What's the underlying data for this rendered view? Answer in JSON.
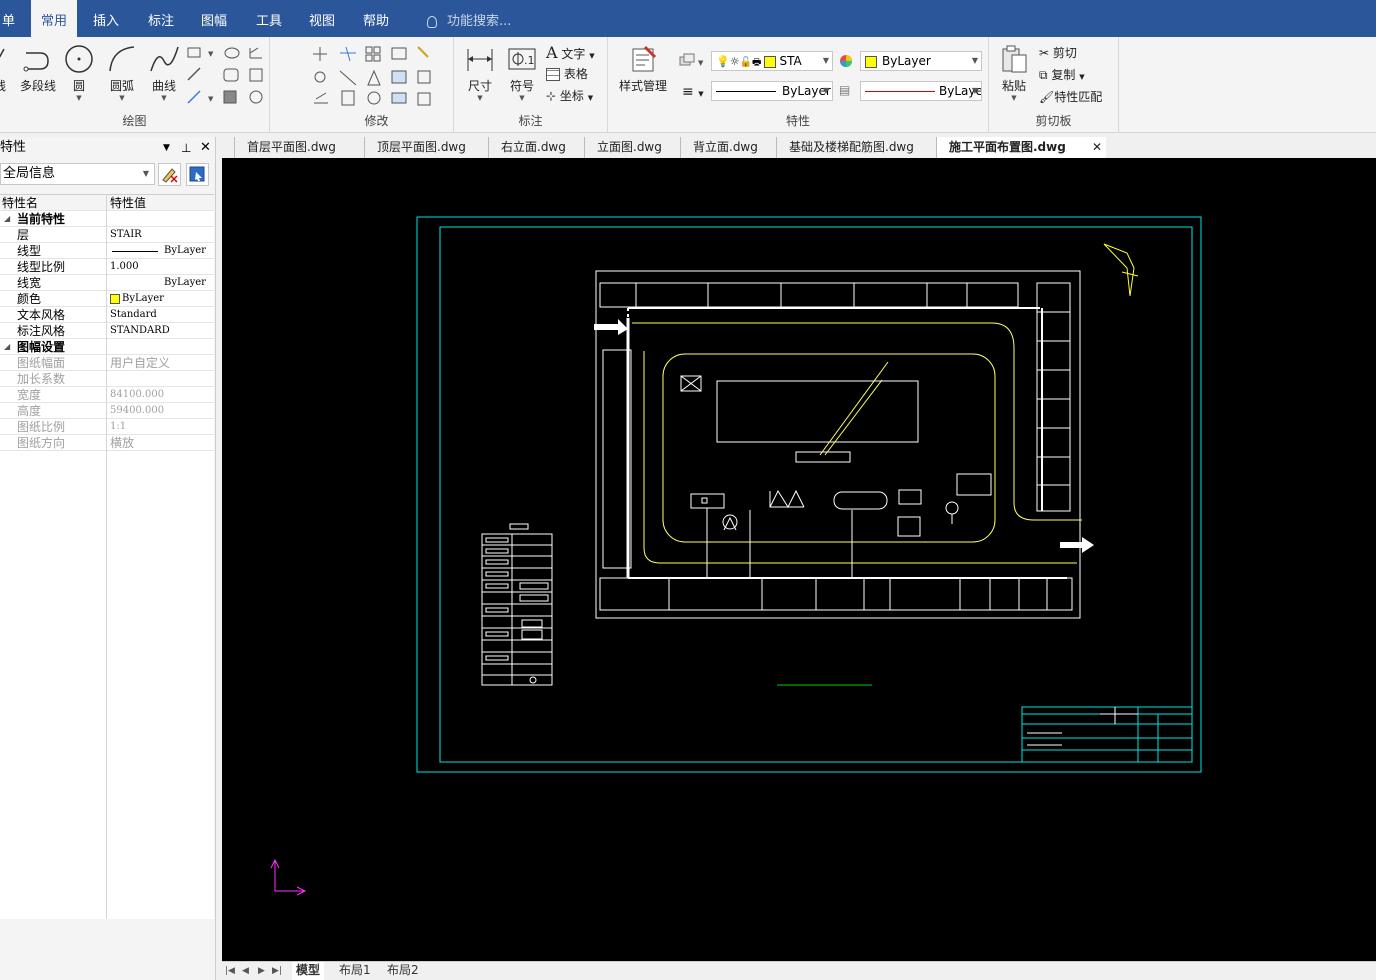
{
  "menu": {
    "items": [
      {
        "label": "单",
        "active": false
      },
      {
        "label": "常用",
        "active": true
      },
      {
        "label": "插入",
        "active": false
      },
      {
        "label": "标注",
        "active": false
      },
      {
        "label": "图幅",
        "active": false
      },
      {
        "label": "工具",
        "active": false
      },
      {
        "label": "视图",
        "active": false
      },
      {
        "label": "帮助",
        "active": false
      }
    ],
    "search_placeholder": "功能搜索..."
  },
  "ribbon": {
    "draw": {
      "label": "绘图",
      "line": "线",
      "polyline": "多段线",
      "circle": "圆",
      "arc": "圆弧",
      "curve": "曲线"
    },
    "modify": {
      "label": "修改"
    },
    "annotate": {
      "label": "标注",
      "dimension": "尺寸",
      "symbol": "符号",
      "text": "文字",
      "table": "表格",
      "coordinate": "坐标"
    },
    "properties": {
      "label": "特性",
      "style_manager": "样式管理",
      "layer_name": "STA",
      "color_value": "ByLayer",
      "linetype_value": "ByLayer",
      "lineweight_value": "ByLaye"
    },
    "clipboard": {
      "label": "剪切板",
      "paste": "粘贴",
      "cut": "剪切",
      "copy": "复制",
      "match": "特性匹配"
    }
  },
  "panel": {
    "title": "特性",
    "scope": "全局信息",
    "col_name": "特性名",
    "col_value": "特性值",
    "categories": [
      {
        "name": "当前特性",
        "rows": [
          {
            "k": "层",
            "v": "STAIR"
          },
          {
            "k": "线型",
            "v": "ByLayer"
          },
          {
            "k": "线型比例",
            "v": "1.000"
          },
          {
            "k": "线宽",
            "v": "ByLayer"
          },
          {
            "k": "颜色",
            "v": "ByLayer"
          },
          {
            "k": "文本风格",
            "v": "Standard"
          },
          {
            "k": "标注风格",
            "v": "STANDARD"
          }
        ]
      },
      {
        "name": "图幅设置",
        "rows": [
          {
            "k": "图纸幅面",
            "v": "用户自定义"
          },
          {
            "k": "加长系数",
            "v": ""
          },
          {
            "k": "宽度",
            "v": "84100.000"
          },
          {
            "k": "高度",
            "v": "59400.000"
          },
          {
            "k": "图纸比例",
            "v": "1:1"
          },
          {
            "k": "图纸方向",
            "v": "横放"
          }
        ]
      }
    ]
  },
  "tabs": [
    {
      "label": "首层平面图.dwg",
      "active": false
    },
    {
      "label": "顶层平面图.dwg",
      "active": false
    },
    {
      "label": "右立面.dwg",
      "active": false
    },
    {
      "label": "立面图.dwg",
      "active": false
    },
    {
      "label": "背立面.dwg",
      "active": false
    },
    {
      "label": "基础及楼梯配筋图.dwg",
      "active": false
    },
    {
      "label": "施工平面布置图.dwg",
      "active": true
    }
  ],
  "layout_tabs": [
    {
      "label": "模型",
      "active": true
    },
    {
      "label": "布局1",
      "active": false
    },
    {
      "label": "布局2",
      "active": false
    }
  ],
  "colors": {
    "menubar": "#2b579a",
    "canvas": "#000000",
    "frame": "#00e5e5",
    "drawing": "#ffffff",
    "road": "#ffff66",
    "ucs": "#ff33ff",
    "layer_color": "#ffff00"
  }
}
